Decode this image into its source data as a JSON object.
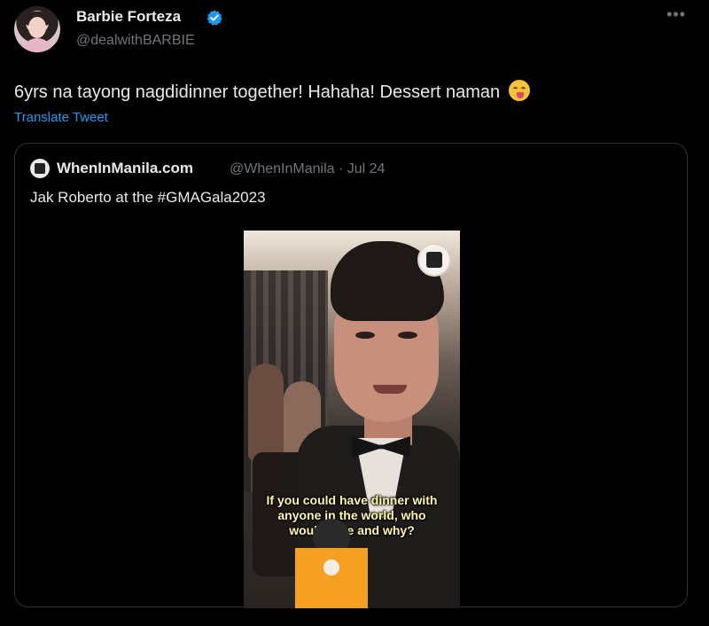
{
  "author": {
    "name": "Barbie Forteza",
    "handle": "@dealwithBARBIE",
    "verified_icon": "verified-check-icon"
  },
  "tweet": {
    "text": "6yrs na tayong nagdidinner together! Hahaha! Dessert naman",
    "emoji": "face-savoring-food-emoji"
  },
  "translate_link": "Translate Tweet",
  "quoted": {
    "name": "WhenInManila.com",
    "handle_date": "@WhenInManila · Jul 24",
    "text": "Jak Roberto at the #GMAGala2023",
    "video_caption": "If you could have dinner with anyone in the world, who would it be and why?"
  },
  "colors": {
    "background": "#000000",
    "text": "#e7e9ea",
    "secondary": "#71767b",
    "link": "#1d9bf0",
    "verified": "#1d9bf0",
    "border": "#2f3336"
  },
  "icons": {
    "more": "more-options-icon"
  }
}
